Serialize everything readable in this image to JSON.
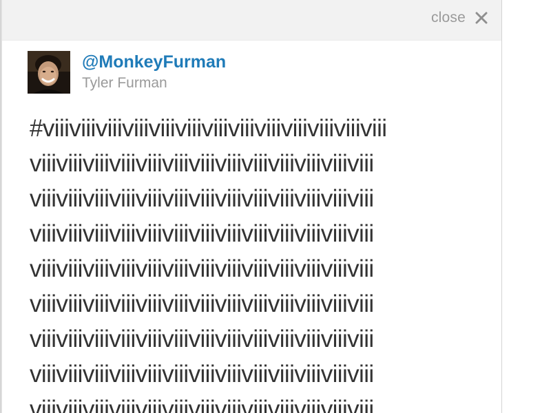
{
  "header": {
    "close_label": "close",
    "close_icon": "close-x-icon"
  },
  "user": {
    "handle": "@MonkeyFurman",
    "name": "Tyler Furman",
    "avatar_icon": "user-avatar-photo"
  },
  "tweet": {
    "lines": [
      "#viiiviiiviiiviiiviiiviiiviiiviiiviiiviiiviiiviiiviii",
      "viiiviiiviiiviiiviiiviiiviiiviiiviiiviiiviiiviiiviii",
      "viiiviiiviiiviiiviiiviiiviiiviiiviiiviiiviiiviiiviii",
      "viiiviiiviiiviiiviiiviiiviiiviiiviiiviiiviiiviiiviii",
      "viiiviiiviiiviiiviiiviiiviiiviiiviiiviiiviiiviiiviii",
      "viiiviiiviiiviiiviiiviiiviiiviiiviiiviiiviiiviiiviii",
      "viiiviiiviiiviiiviiiviiiviiiviiiviiiviiiviiiviiiviii",
      "viiiviiiviiiviiiviiiviiiviiiviiiviiiviiiviiiviiiviii",
      "viiiviiiviiiviiiviiiviiiviiiviiiviiiviiiviiiviiiviii"
    ]
  },
  "colors": {
    "handle": "#1f7bb8",
    "muted": "#9a9a9a",
    "header_bg": "#f2f2f2",
    "body_text": "#333333"
  }
}
